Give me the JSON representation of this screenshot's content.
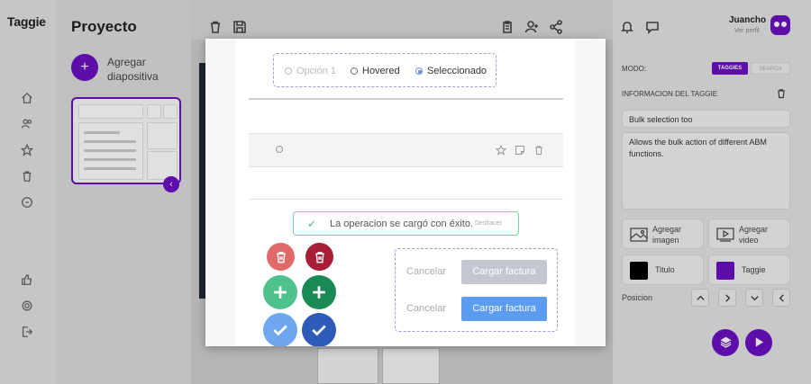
{
  "app": {
    "logo": "Taggie",
    "project_title": "Proyecto"
  },
  "slides": {
    "add_label_line1": "Agregar",
    "add_label_line2": "diapositiva"
  },
  "user": {
    "name": "Juancho",
    "subtitle": "Ver perfil"
  },
  "panel": {
    "mode_label": "MODO:",
    "mode_active": "TAGGIES",
    "mode_inactive": "SEARCH",
    "info_label": "INFORMACION DEL TAGGIE",
    "title_value": "Bulk selection too",
    "description_value": "Allows the bulk action of different ABM functions.",
    "add_image_line1": "Agregar",
    "add_image_line2": "imagen",
    "add_video_line1": "Agregar",
    "add_video_line2": "video",
    "color_title_label": "Titulo",
    "color_taggie_label": "Taggie",
    "position_label": "Posicion",
    "position_buttons": [
      "^",
      ">",
      "v",
      "<"
    ],
    "colors": {
      "titulo": "#000000",
      "taggie": "#6a0fc2"
    }
  },
  "modal": {
    "radios": [
      {
        "label": "Opción 1",
        "state": "disabled"
      },
      {
        "label": "Hovered",
        "state": "hover"
      },
      {
        "label": "Seleccionado",
        "state": "selected"
      }
    ],
    "toast_message": "La operacion se cargó con éxito.",
    "toast_undo": "Deshacer",
    "cancel_label_1": "Cancelar",
    "cancel_label_2": "Cancelar",
    "upload_disabled": "Cargar factura",
    "upload_enabled": "Cargar factura"
  },
  "colors": {
    "accent": "#6a0fc2",
    "success": "#3fbf7f",
    "danger": "#d95a5a",
    "primary_blue": "#5b9cf0"
  }
}
